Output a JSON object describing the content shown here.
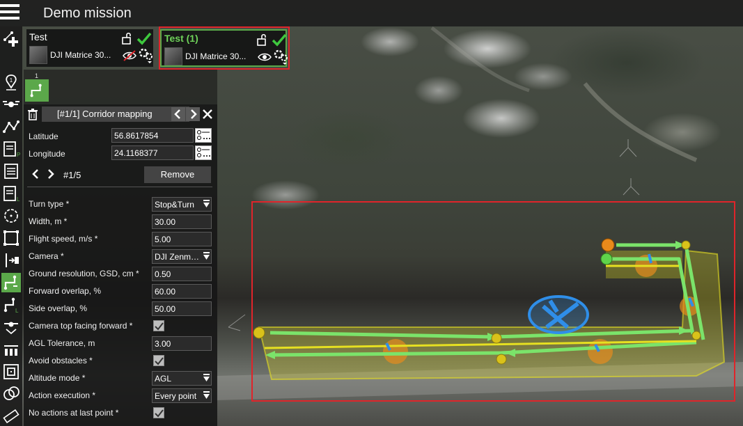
{
  "app": {
    "mission_title": "Demo mission"
  },
  "vehicles": [
    {
      "name": "Test",
      "model": "DJI Matrice 30...",
      "visible": false
    },
    {
      "name": "Test  (1)",
      "model": "DJI Matrice 30...",
      "visible": true,
      "selected": true
    }
  ],
  "route_tab": {
    "number": "1"
  },
  "panel": {
    "title": "[#1/1] Corridor mapping",
    "latitude": {
      "label": "Latitude",
      "value": "56.8617854"
    },
    "longitude": {
      "label": "Longitude",
      "value": "24.1168377"
    },
    "point_counter": "#1/5",
    "remove_label": "Remove",
    "params": [
      {
        "label": "Turn type *",
        "type": "select",
        "value": "Stop&Turn"
      },
      {
        "label": "Width, m *",
        "type": "input",
        "value": "30.00"
      },
      {
        "label": "Flight speed, m/s *",
        "type": "input",
        "value": "5.00"
      },
      {
        "label": "Camera *",
        "type": "select",
        "value": "DJI Zenmuse"
      },
      {
        "label": "Ground resolution, GSD, cm *",
        "type": "input",
        "value": "0.50"
      },
      {
        "label": "Forward overlap, %",
        "type": "input",
        "value": "60.00"
      },
      {
        "label": "Side overlap, %",
        "type": "input",
        "value": "50.00"
      },
      {
        "label": "Camera top facing forward *",
        "type": "checkbox",
        "checked": true
      },
      {
        "label": "AGL Tolerance, m",
        "type": "input",
        "value": "3.00"
      },
      {
        "label": "Avoid obstacles *",
        "type": "checkbox",
        "checked": true
      },
      {
        "label": "Altitude mode *",
        "type": "select",
        "value": "AGL"
      },
      {
        "label": "Action execution *",
        "type": "select",
        "value": "Every point"
      },
      {
        "label": "No actions at last point *",
        "type": "checkbox",
        "checked": true
      }
    ]
  },
  "colors": {
    "accent_green": "#5ba84a",
    "highlight_red": "#e0242a",
    "route_line": "#7be36a",
    "corridor_yellow": "#e6e021",
    "home_marker": "#2f8ee8"
  }
}
